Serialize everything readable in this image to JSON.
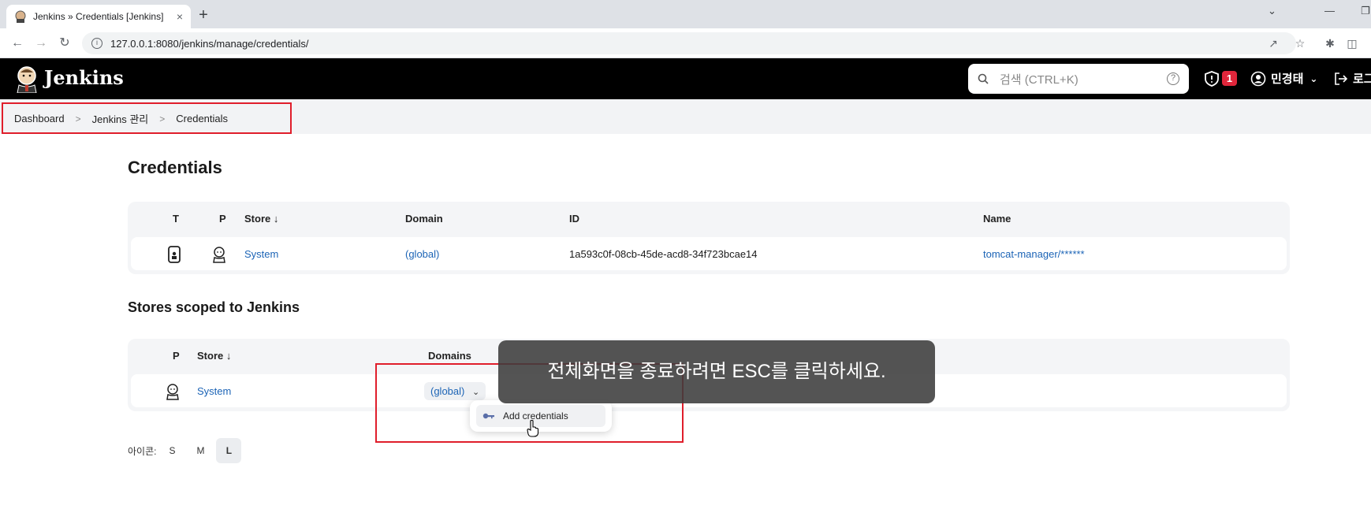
{
  "browser": {
    "tab_title": "Jenkins » Credentials [Jenkins]",
    "tab_close": "×",
    "new_tab": "+",
    "url": "127.0.0.1:8080/jenkins/manage/credentials/"
  },
  "header": {
    "brand": "Jenkins",
    "search_placeholder": "검색 (CTRL+K)",
    "security_badge_count": "1",
    "user_name": "민경태",
    "logout_label": "로그아웃"
  },
  "breadcrumb": [
    "Dashboard",
    "Jenkins 관리",
    "Credentials"
  ],
  "credentials": {
    "title": "Credentials",
    "columns": [
      "T",
      "P",
      "Store ↓",
      "Domain",
      "ID",
      "Name"
    ],
    "rows": [
      {
        "store": "System",
        "domain": "(global)",
        "id": "1a593c0f-08cb-45de-acd8-34f723bcae14",
        "name": "tomcat-manager/******"
      }
    ]
  },
  "stores": {
    "title": "Stores scoped to Jenkins",
    "columns": [
      "P",
      "Store ↓",
      "Domains"
    ],
    "rows": [
      {
        "store": "System",
        "domain": "(global)"
      }
    ],
    "dropdown_item": "Add credentials"
  },
  "overlay_text": "전체화면을 종료하려면 ESC를 클릭하세요.",
  "icon_size": {
    "label": "아이콘:",
    "options": [
      "S",
      "M",
      "L"
    ],
    "selected": "L"
  },
  "colors": {
    "header_bg": "#000000",
    "link": "#1c64b6",
    "highlight_box": "#e01e2b",
    "badge": "#e0263b"
  }
}
